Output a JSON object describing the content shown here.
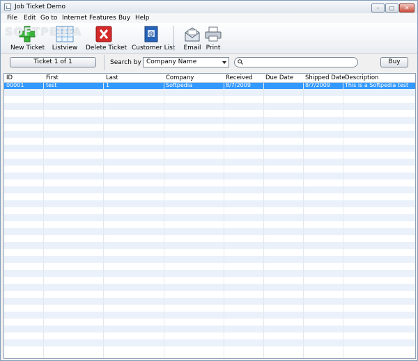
{
  "window": {
    "title": "Job Ticket Demo"
  },
  "menu": [
    "File",
    "Edit",
    "Go to",
    "Internet",
    "Features",
    "Buy",
    "Help"
  ],
  "toolbar": {
    "new_ticket": "New Ticket",
    "listview": "Listview",
    "delete_ticket": "Delete Ticket",
    "customer_list": "Customer List",
    "email": "Email",
    "print": "Print",
    "watermark": "SOFTPEDIA"
  },
  "filter": {
    "ticket_counter": "Ticket 1 of 1",
    "search_by_label": "Search by",
    "search_by_value": "Company Name",
    "search_value": "",
    "buy_label": "Buy"
  },
  "grid": {
    "columns": [
      "ID",
      "First",
      "Last",
      "Company",
      "Received",
      "Due Date",
      "Shipped Date",
      "Description"
    ],
    "rows": [
      [
        "00001",
        "test",
        "1",
        "Softpedia",
        "8/7/2009",
        "",
        "8/7/2009",
        "This is a Softpedia test"
      ]
    ]
  },
  "colors": {
    "selection": "#3399ff",
    "stripe": "#eaf1fa"
  }
}
